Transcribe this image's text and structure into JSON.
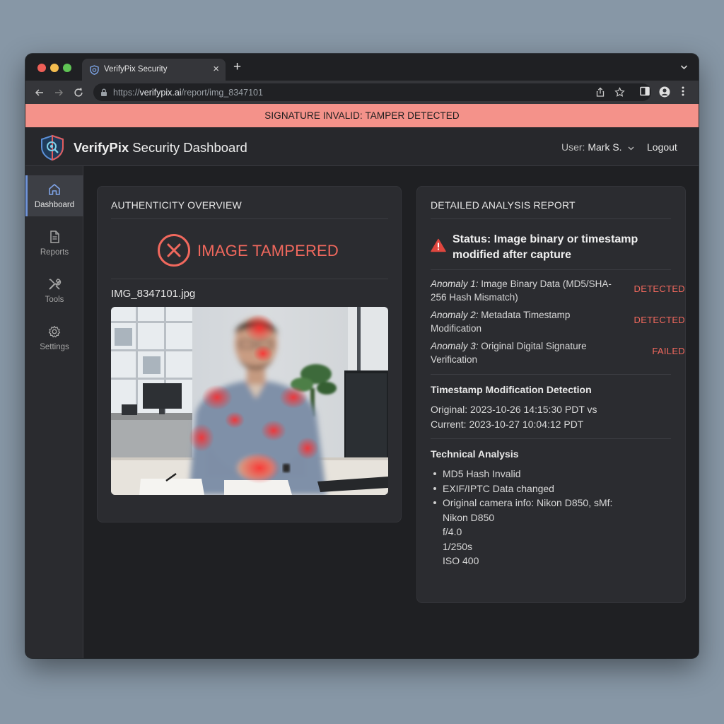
{
  "browser": {
    "tab_title": "VerifyPix Security",
    "tab_close": "×",
    "new_tab": "+",
    "url_prefix": "https://",
    "url_host": "verifypix.ai",
    "url_path": "/report/img_8347101"
  },
  "alert": {
    "text": "SIGNATURE INVALID: TAMPER DETECTED"
  },
  "header": {
    "brand": "VerifyPix",
    "title_rest": " Security Dashboard",
    "user_label": "User: ",
    "user_name": "Mark S.",
    "logout": "Logout"
  },
  "sidebar": {
    "items": [
      {
        "label": "Dashboard",
        "icon": "home-icon",
        "active": true
      },
      {
        "label": "Reports",
        "icon": "document-icon",
        "active": false
      },
      {
        "label": "Tools",
        "icon": "tools-icon",
        "active": false
      },
      {
        "label": "Settings",
        "icon": "gear-icon",
        "active": false
      }
    ]
  },
  "overview": {
    "title": "AUTHENTICITY OVERVIEW",
    "verdict": "IMAGE TAMPERED",
    "filename": "IMG_8347101.jpg"
  },
  "report": {
    "title": "DETAILED ANALYSIS REPORT",
    "status": "Status: Image binary or timestamp modified after capture",
    "anomalies": [
      {
        "prefix": "Anomaly 1:",
        "text": " Image Binary Data (MD5/SHA-256 Hash Mismatch)",
        "status": "DETECTED"
      },
      {
        "prefix": "Anomaly 2:",
        "text": " Metadata Timestamp Modification",
        "status": "DETECTED"
      },
      {
        "prefix": "Anomaly 3:",
        "text": " Original Digital Signature Verification",
        "status": "FAILED"
      }
    ],
    "timestamp_title": "Timestamp Modification Detection",
    "timestamp_original": "Original: 2023-10-26 14:15:30 PDT vs",
    "timestamp_current": "Current: 2023-10-27 10:04:12 PDT",
    "technical_title": "Technical Analysis",
    "technical_items": [
      "MD5 Hash Invalid",
      "EXIF/IPTC Data changed",
      "Original camera info: Nikon D850, sMf:"
    ],
    "camera_lines": [
      "Nikon D850",
      "f/4.0",
      "1/250s",
      "ISO 400"
    ]
  },
  "colors": {
    "alert_bg": "#f4928a",
    "danger": "#f0685d",
    "active_accent": "#6f93d8"
  }
}
